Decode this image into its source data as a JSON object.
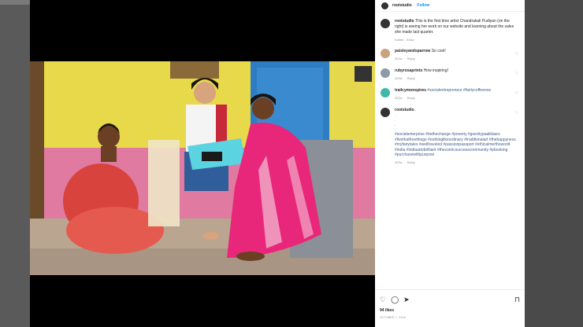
{
  "post": {
    "author": "rootstudio",
    "follow_label": "Follow",
    "caption_author": "rootstudio",
    "caption_text": "This is the first time artist Chandrakali Pudiyan (on the right) is seeing her work on our website and learning about the sales she made last quarter.",
    "caption_meta": "Edited · 318w"
  },
  "comments": [
    {
      "user": "paisleyandsparrow",
      "text": "So cool!",
      "age": "322w",
      "reply": "Reply"
    },
    {
      "user": "rubyrosaprints",
      "text": "How inspiring!",
      "age": "322w",
      "reply": "Reply"
    },
    {
      "user": "trailcymonspires",
      "text": "#socialentrepreneur #fairlycoffeerow",
      "age": "322w",
      "reply": "Reply"
    },
    {
      "user": "rootstudio",
      "text": ".",
      "hashtags": "#socialenterprise #bethechange #poverty #goedrypaalklaars #livethatfreethings #nothinglikeordinary #traditionalart #thehappyness #myfairytales #welltraveled #passionpassport #ethicalmerthsworld #india #indiaartobrilliant #thecomicsuccesscommunity #pbooking #purchasewithpurpose",
      "age": "322w",
      "reply": "Reply"
    }
  ],
  "actions": {
    "like_icon": "heart-outline-icon",
    "comment_icon": "comment-icon",
    "share_icon": "send-icon",
    "save_icon": "bookmark-icon"
  },
  "likes": "94 likes",
  "date": "OCTOBER 7, 2016"
}
